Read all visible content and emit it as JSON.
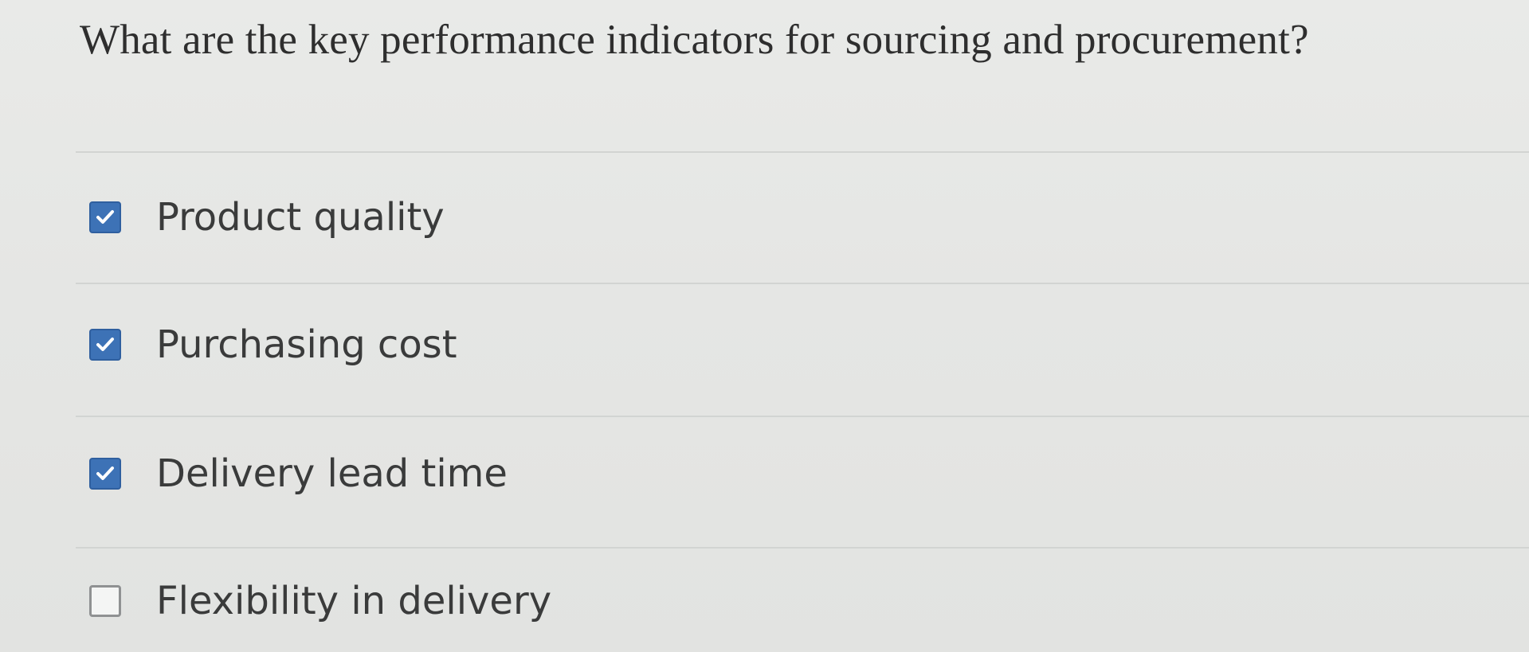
{
  "question": {
    "text": "What are the key performance indicators for sourcing and procurement?"
  },
  "options": [
    {
      "label": "Product quality",
      "checked": true
    },
    {
      "label": "Purchasing cost",
      "checked": true
    },
    {
      "label": "Delivery lead time",
      "checked": true
    },
    {
      "label": "Flexibility in delivery",
      "checked": false
    }
  ],
  "colors": {
    "checked_fill": "#3d72b6",
    "unchecked_border": "#8f9192",
    "background": "#e7e8e6",
    "text": "#3a3b3b"
  },
  "icons": {
    "checked": "checkmark-icon"
  }
}
